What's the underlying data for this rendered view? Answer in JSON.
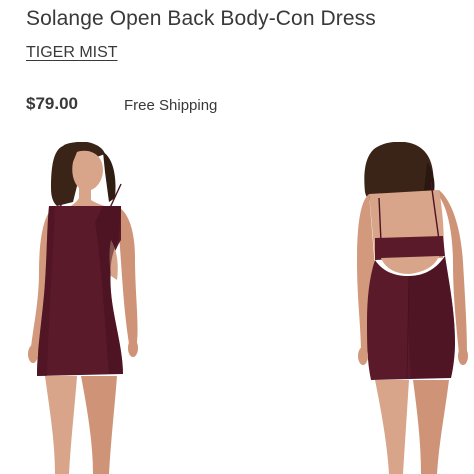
{
  "product": {
    "title": "Solange Open Back Body-Con Dress",
    "brand": "TIGER MIST",
    "price": "$79.00",
    "shipping": "Free Shipping"
  },
  "gallery": {
    "images": [
      {
        "view": "front",
        "alt": "Model wearing burgundy body-con dress, front view"
      },
      {
        "view": "back",
        "alt": "Model wearing burgundy body-con dress, back view showing open back"
      }
    ]
  },
  "colors": {
    "text": "#393939",
    "dress": "#5b1a2a",
    "dress_shadow": "#43101d",
    "skin": "#d9a58a",
    "skin_shadow": "#c48c70",
    "hair": "#3a2418"
  }
}
